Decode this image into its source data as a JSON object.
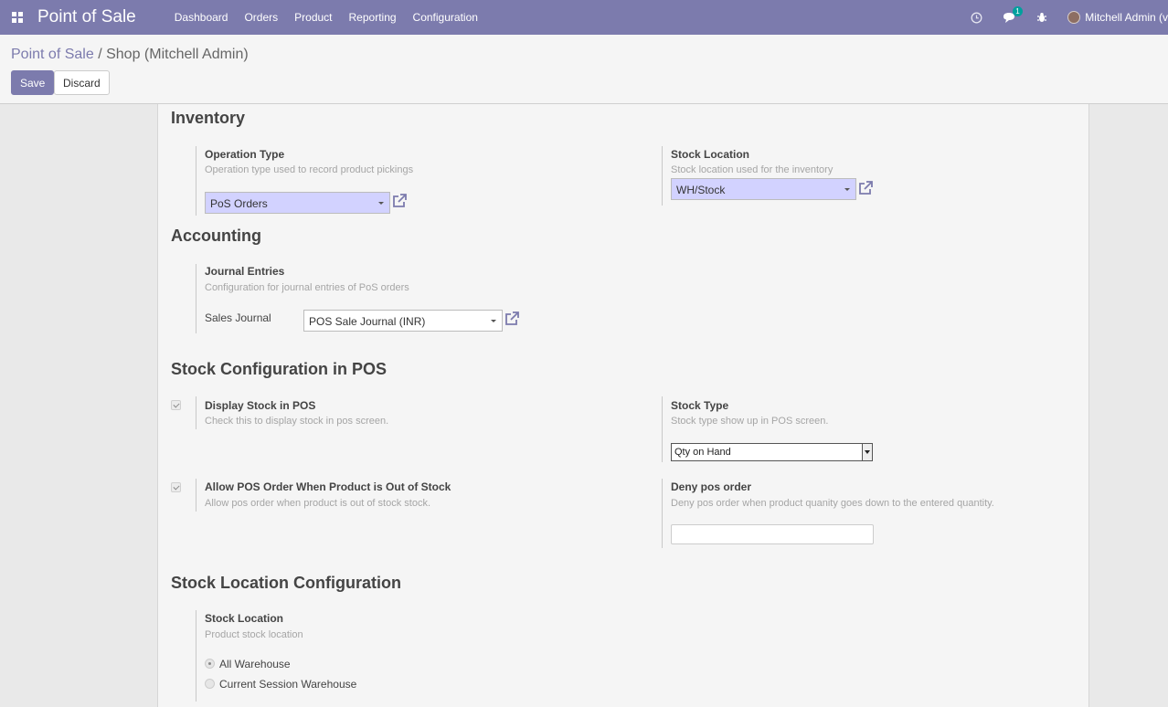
{
  "navbar": {
    "brand": "Point of Sale",
    "menu": [
      "Dashboard",
      "Orders",
      "Product",
      "Reporting",
      "Configuration"
    ],
    "chat_count": "1",
    "user": "Mitchell Admin (v"
  },
  "breadcrumb": {
    "parent": "Point of Sale",
    "separator": "/",
    "current": "Shop (Mitchell Admin)"
  },
  "buttons": {
    "save": "Save",
    "discard": "Discard"
  },
  "inventory": {
    "title": "Inventory",
    "operation_type": {
      "label": "Operation Type",
      "help": "Operation type used to record product pickings",
      "value": "PoS Orders"
    },
    "stock_location": {
      "label": "Stock Location",
      "help": "Stock location used for the inventory",
      "value": "WH/Stock"
    }
  },
  "accounting": {
    "title": "Accounting",
    "journal": {
      "label": "Journal Entries",
      "help": "Configuration for journal entries of PoS orders",
      "field_label": "Sales Journal",
      "value": "POS Sale Journal (INR)"
    }
  },
  "stock_config": {
    "title": "Stock Configuration in POS",
    "display_stock": {
      "label": "Display Stock in POS",
      "help": "Check this to display stock in pos screen.",
      "checked": true
    },
    "stock_type": {
      "label": "Stock Type",
      "help": "Stock type show up in POS screen.",
      "value": "Qty on Hand"
    },
    "allow_order": {
      "label": "Allow POS Order When Product is Out of Stock",
      "help": "Allow pos order when product is out of stock stock.",
      "checked": true
    },
    "deny_order": {
      "label": "Deny pos order",
      "help": "Deny pos order when product quanity goes down to the entered quantity.",
      "value": ""
    }
  },
  "stock_location_config": {
    "title": "Stock Location Configuration",
    "stock_location": {
      "label": "Stock Location",
      "help": "Product stock location",
      "options": [
        "All Warehouse",
        "Current Session Warehouse"
      ],
      "selected": "All Warehouse"
    }
  },
  "colors": {
    "navbar": "#7c7bad",
    "required_field": "#d2d2ff",
    "badge": "#00a09d"
  }
}
